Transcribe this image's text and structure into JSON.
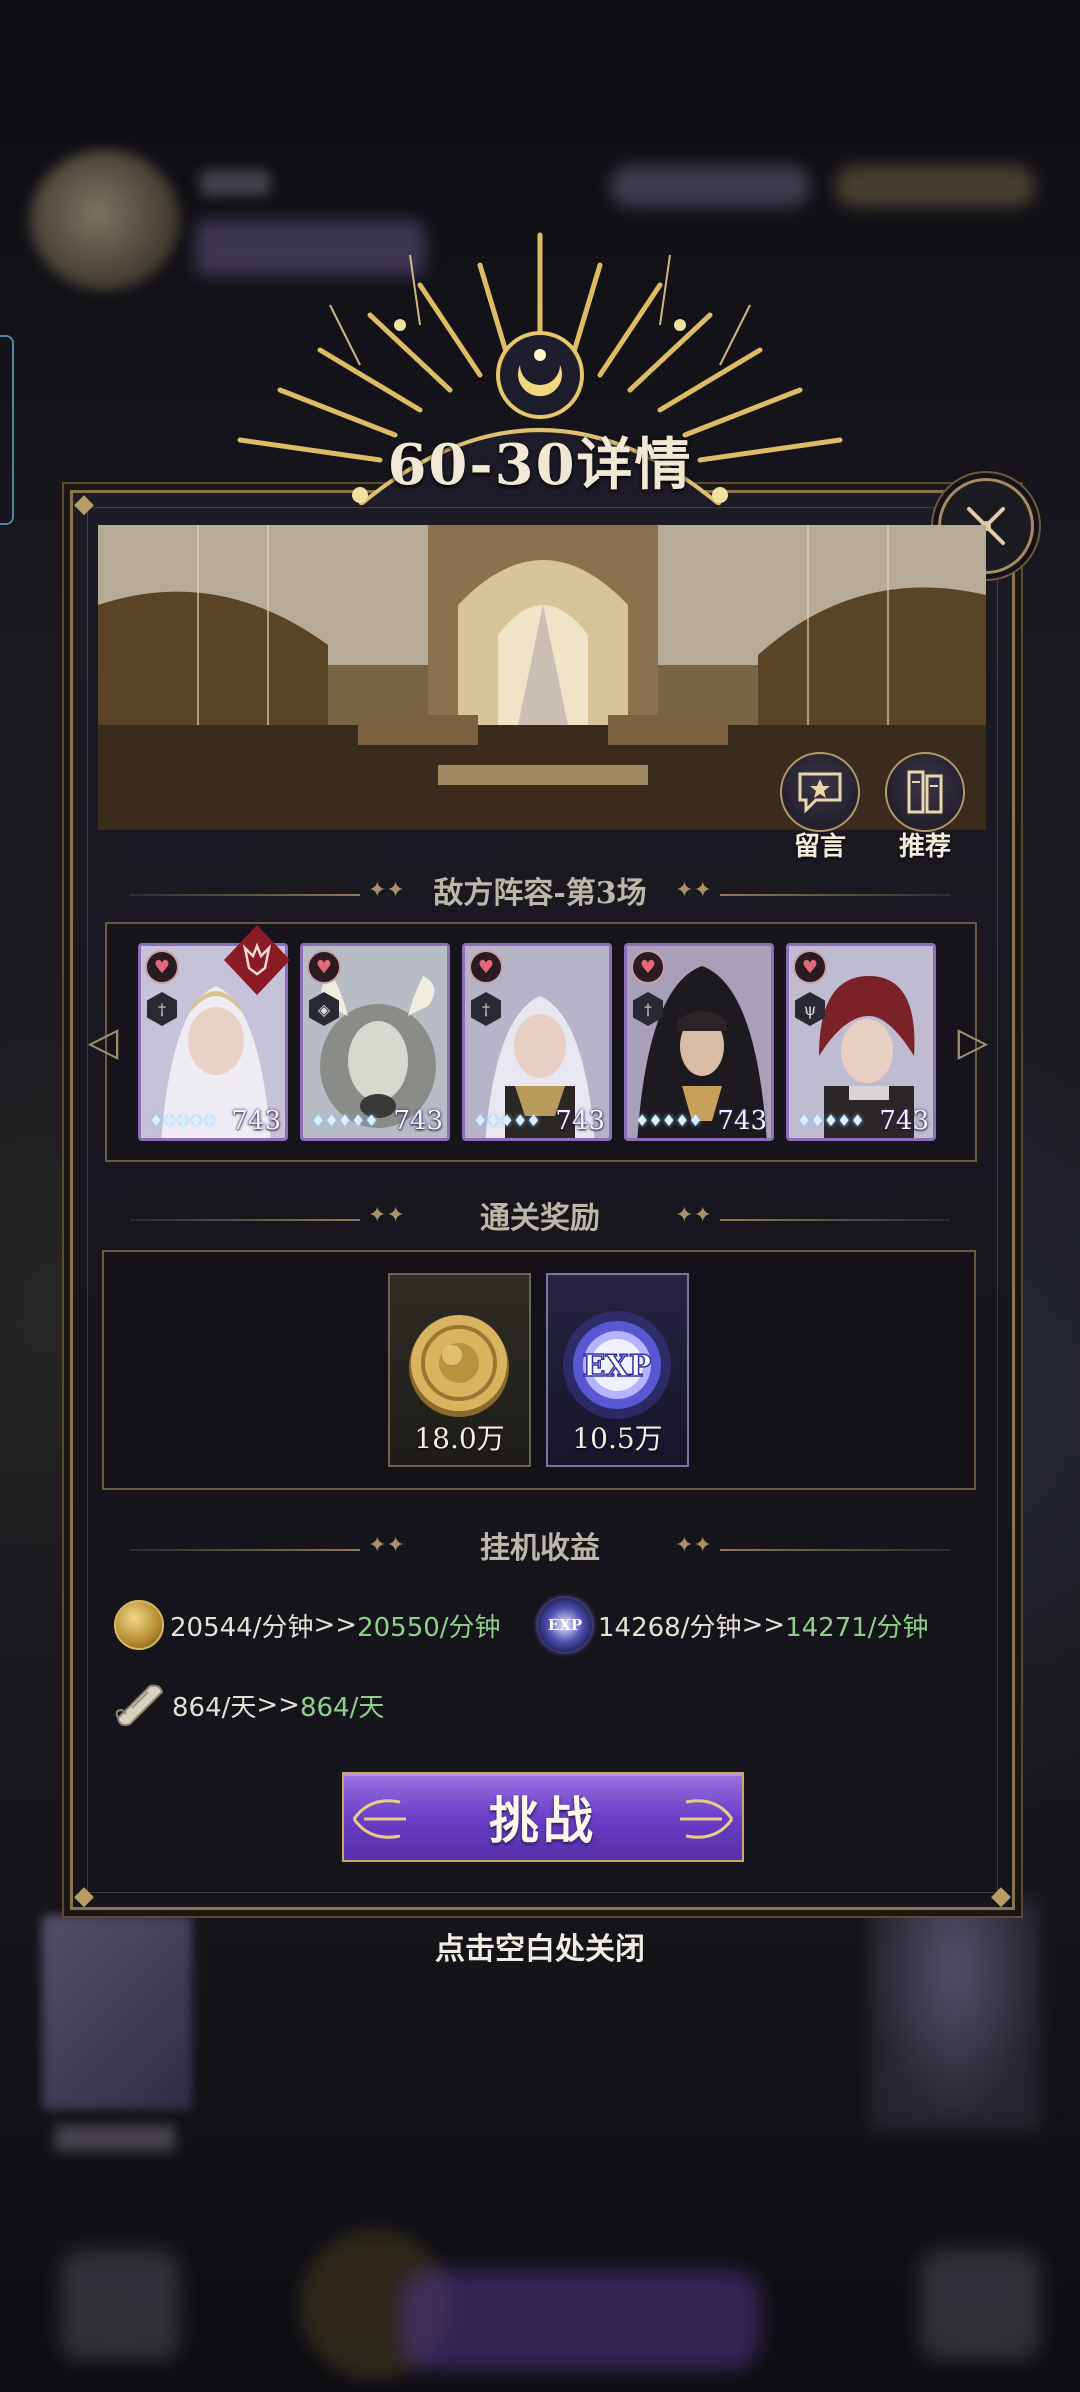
{
  "dialog": {
    "title": "60-30详情",
    "close_hint": "点击空白处关闭"
  },
  "scene": {
    "message_label": "留言",
    "recommend_label": "推荐"
  },
  "enemy": {
    "header": "敌方阵容-第3场",
    "cards": [
      {
        "level": "743",
        "role": "sword",
        "boss": true
      },
      {
        "level": "743",
        "role": "shield",
        "boss": false
      },
      {
        "level": "743",
        "role": "sword",
        "boss": false
      },
      {
        "level": "743",
        "role": "sword",
        "boss": false
      },
      {
        "level": "743",
        "role": "staff",
        "boss": false
      }
    ]
  },
  "rewards": {
    "header": "通关奖励",
    "items": [
      {
        "icon": "gold-coin-icon",
        "amount": "18.0万"
      },
      {
        "icon": "exp-orb-icon",
        "amount": "10.5万"
      }
    ]
  },
  "idle": {
    "header": "挂机收益",
    "gold": {
      "current": "20544/分钟",
      "arrow": ">>",
      "next": "20550/分钟"
    },
    "exp": {
      "icon_text": "EXP",
      "current": "14268/分钟",
      "arrow": ">>",
      "next": "14271/分钟"
    },
    "scroll": {
      "current": "864/天",
      "arrow": ">>",
      "next": "864/天"
    }
  },
  "challenge_button": {
    "label": "挑战"
  },
  "colors": {
    "panel_border": "#8a7450",
    "accent_gold": "#c8a86a",
    "button_purple": "#6a3fc8",
    "income_up": "#8ed08a"
  }
}
